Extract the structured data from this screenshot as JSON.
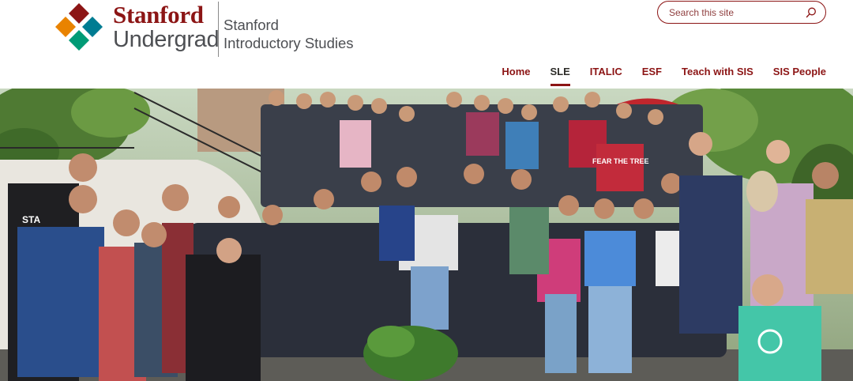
{
  "brand": {
    "line1": "Stanford",
    "line2": "Undergrad",
    "site_name_line1": "Stanford",
    "site_name_line2": "Introductory Studies",
    "logo_colors": [
      "#8c1515",
      "#e98300",
      "#009b76",
      "#007c92"
    ]
  },
  "search": {
    "placeholder": "Search this site",
    "value": "",
    "icon": "search-icon"
  },
  "nav": {
    "active": "SLE",
    "items": [
      {
        "label": "Home"
      },
      {
        "label": "SLE"
      },
      {
        "label": "ITALIC"
      },
      {
        "label": "ESF"
      },
      {
        "label": "Teach with SIS"
      },
      {
        "label": "SIS People"
      }
    ]
  },
  "hero": {
    "image": "group-photo",
    "shirt_text_1": "STA",
    "shirt_text_2": "FEAR THE TREE"
  },
  "colors": {
    "accent": "#8c1515",
    "nav_active_text": "#2e2d29",
    "secondary_text": "#4d4f53"
  }
}
